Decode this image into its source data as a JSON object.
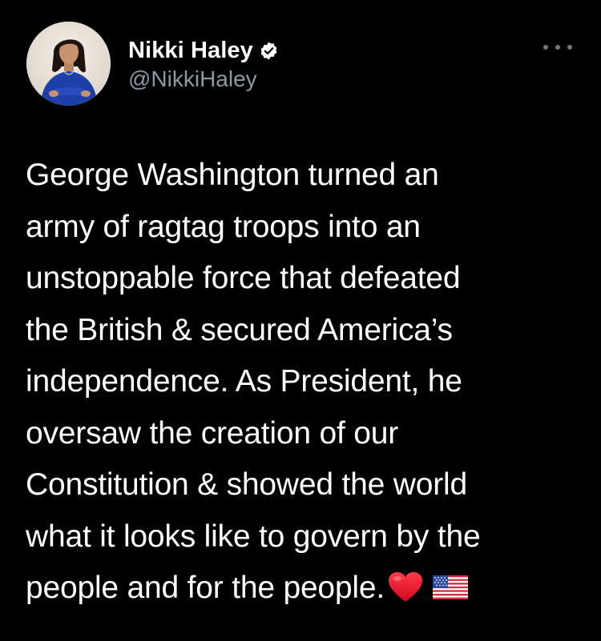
{
  "author": {
    "display_name": "Nikki Haley",
    "handle": "@NikkiHaley",
    "verified": true,
    "avatar_icon": "profile-photo"
  },
  "menu": {
    "icon": "more-options-icon"
  },
  "tweet": {
    "lines": [
      "George Washington turned an",
      "army of ragtag troops into an",
      "unstoppable force that defeated",
      "the British & secured America’s",
      "independence. As President, he",
      "oversaw the creation of our",
      "Constitution & showed the world",
      "what it looks like to govern by the",
      "people and for the people."
    ],
    "emojis": [
      "red-heart",
      "us-flag"
    ]
  },
  "colors": {
    "background": "#000000",
    "text": "#ffffff",
    "secondary_text": "#8b98a5",
    "verified_badge": "#ffffff"
  }
}
